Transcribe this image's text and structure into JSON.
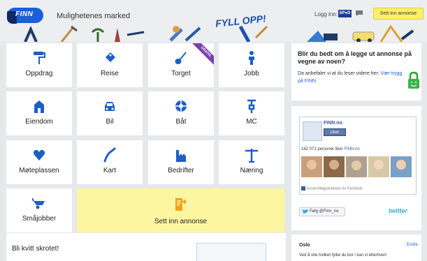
{
  "header": {
    "logo_text": "FINN",
    "tagline": "Mulighetenes marked",
    "login_label": "Logg inn:",
    "spid_label": "SP●D",
    "sett_inn_button": "Sett inn annonse"
  },
  "tiles": [
    {
      "label": "Oppdrag",
      "icon": "paint-roller-icon"
    },
    {
      "label": "Reise",
      "icon": "luggage-tag-icon"
    },
    {
      "label": "Torget",
      "icon": "guitar-icon",
      "badge": "GRATIS"
    },
    {
      "label": "Jobb",
      "icon": "worker-icon"
    },
    {
      "label": "Eiendom",
      "icon": "house-icon"
    },
    {
      "label": "Bil",
      "icon": "car-icon"
    },
    {
      "label": "Båt",
      "icon": "life-buoy-icon"
    },
    {
      "label": "MC",
      "icon": "motorcycle-icon"
    },
    {
      "label": "Møteplassen",
      "icon": "heart-icon"
    },
    {
      "label": "Kart",
      "icon": "map-pin-icon"
    },
    {
      "label": "Bedrifter",
      "icon": "factory-icon"
    },
    {
      "label": "Næring",
      "icon": "crane-icon"
    },
    {
      "label": "Småjobber",
      "icon": "wheelbarrow-icon"
    }
  ],
  "sett_inn_tile": {
    "label": "Sett inn annonse",
    "icon": "new-ad-icon"
  },
  "bottom": {
    "kvitt_title": "Bli kvitt skrotet!",
    "fyll_label": "FYLL OPP!"
  },
  "promo": {
    "title": "Blir du bedt om å legge ut annonse på vegne av noen?",
    "text": "Da anbefaler vi at du leser videre her: ",
    "link": "Vær trygg på FINN"
  },
  "facebook": {
    "page_name": "FINN.no",
    "like_button": "Liker",
    "count_text": "162 071 personer liker ",
    "count_link": "FINN.no",
    "footer": "Sosial tilleggsfunksjon for Facebook"
  },
  "twitter": {
    "follow_button": "Følg @Finn_no",
    "logo": "twitter"
  },
  "oslo": {
    "title": "Oslo",
    "edit": "Endre",
    "text": "Ved å vite hvilket fylke du bor i kan vi etterhvert"
  },
  "colors": {
    "brand_blue": "#1a5fd6",
    "yellow": "#ffef6b",
    "tile_yellow": "#fdf6a0",
    "facebook_blue": "#3b5998",
    "twitter_blue": "#35ace0"
  }
}
